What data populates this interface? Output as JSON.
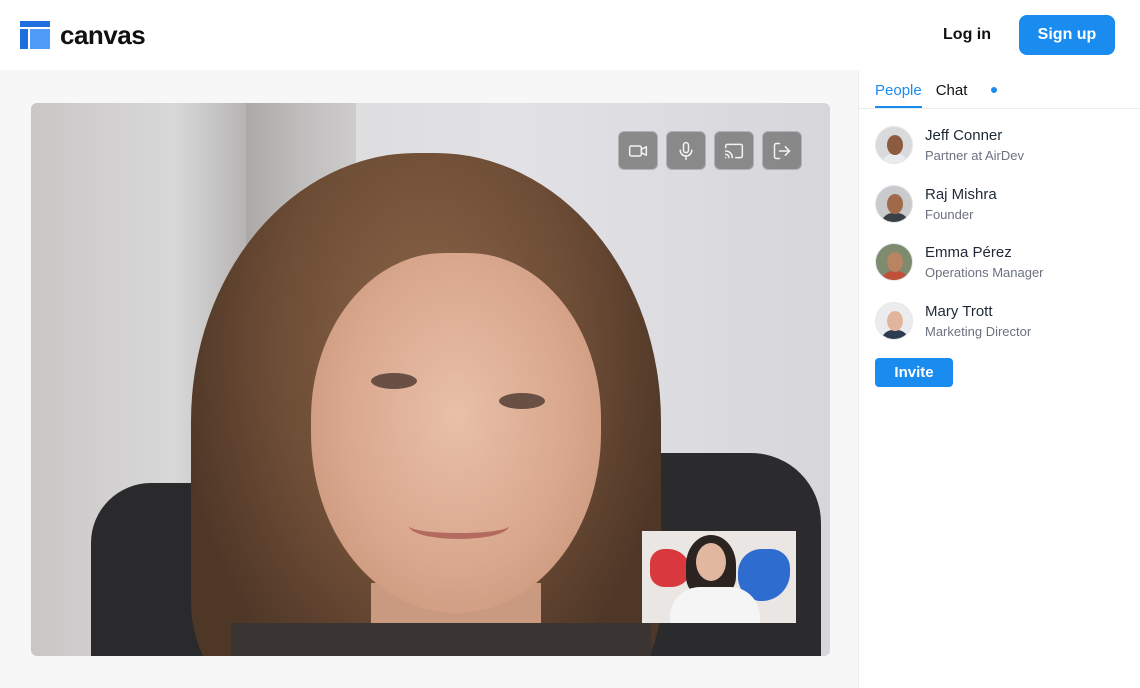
{
  "header": {
    "brand": "canvas",
    "login_label": "Log in",
    "signup_label": "Sign up"
  },
  "call": {
    "controls": [
      {
        "icon": "video-camera-icon"
      },
      {
        "icon": "microphone-icon"
      },
      {
        "icon": "screen-cast-icon"
      },
      {
        "icon": "leave-call-icon"
      }
    ]
  },
  "sidebar": {
    "tabs": {
      "people": "People",
      "chat": "Chat"
    },
    "people": [
      {
        "name": "Jeff Conner",
        "role": "Partner at AirDev"
      },
      {
        "name": "Raj Mishra",
        "role": "Founder"
      },
      {
        "name": "Emma Pérez",
        "role": "Operations Manager"
      },
      {
        "name": "Mary Trott",
        "role": "Marketing Director"
      }
    ],
    "invite_label": "Invite"
  },
  "colors": {
    "accent": "#1a8cf0",
    "logo_dark": "#1d6fe0",
    "logo_light": "#4f9bf5",
    "stage_bg": "#f7f7f8"
  }
}
